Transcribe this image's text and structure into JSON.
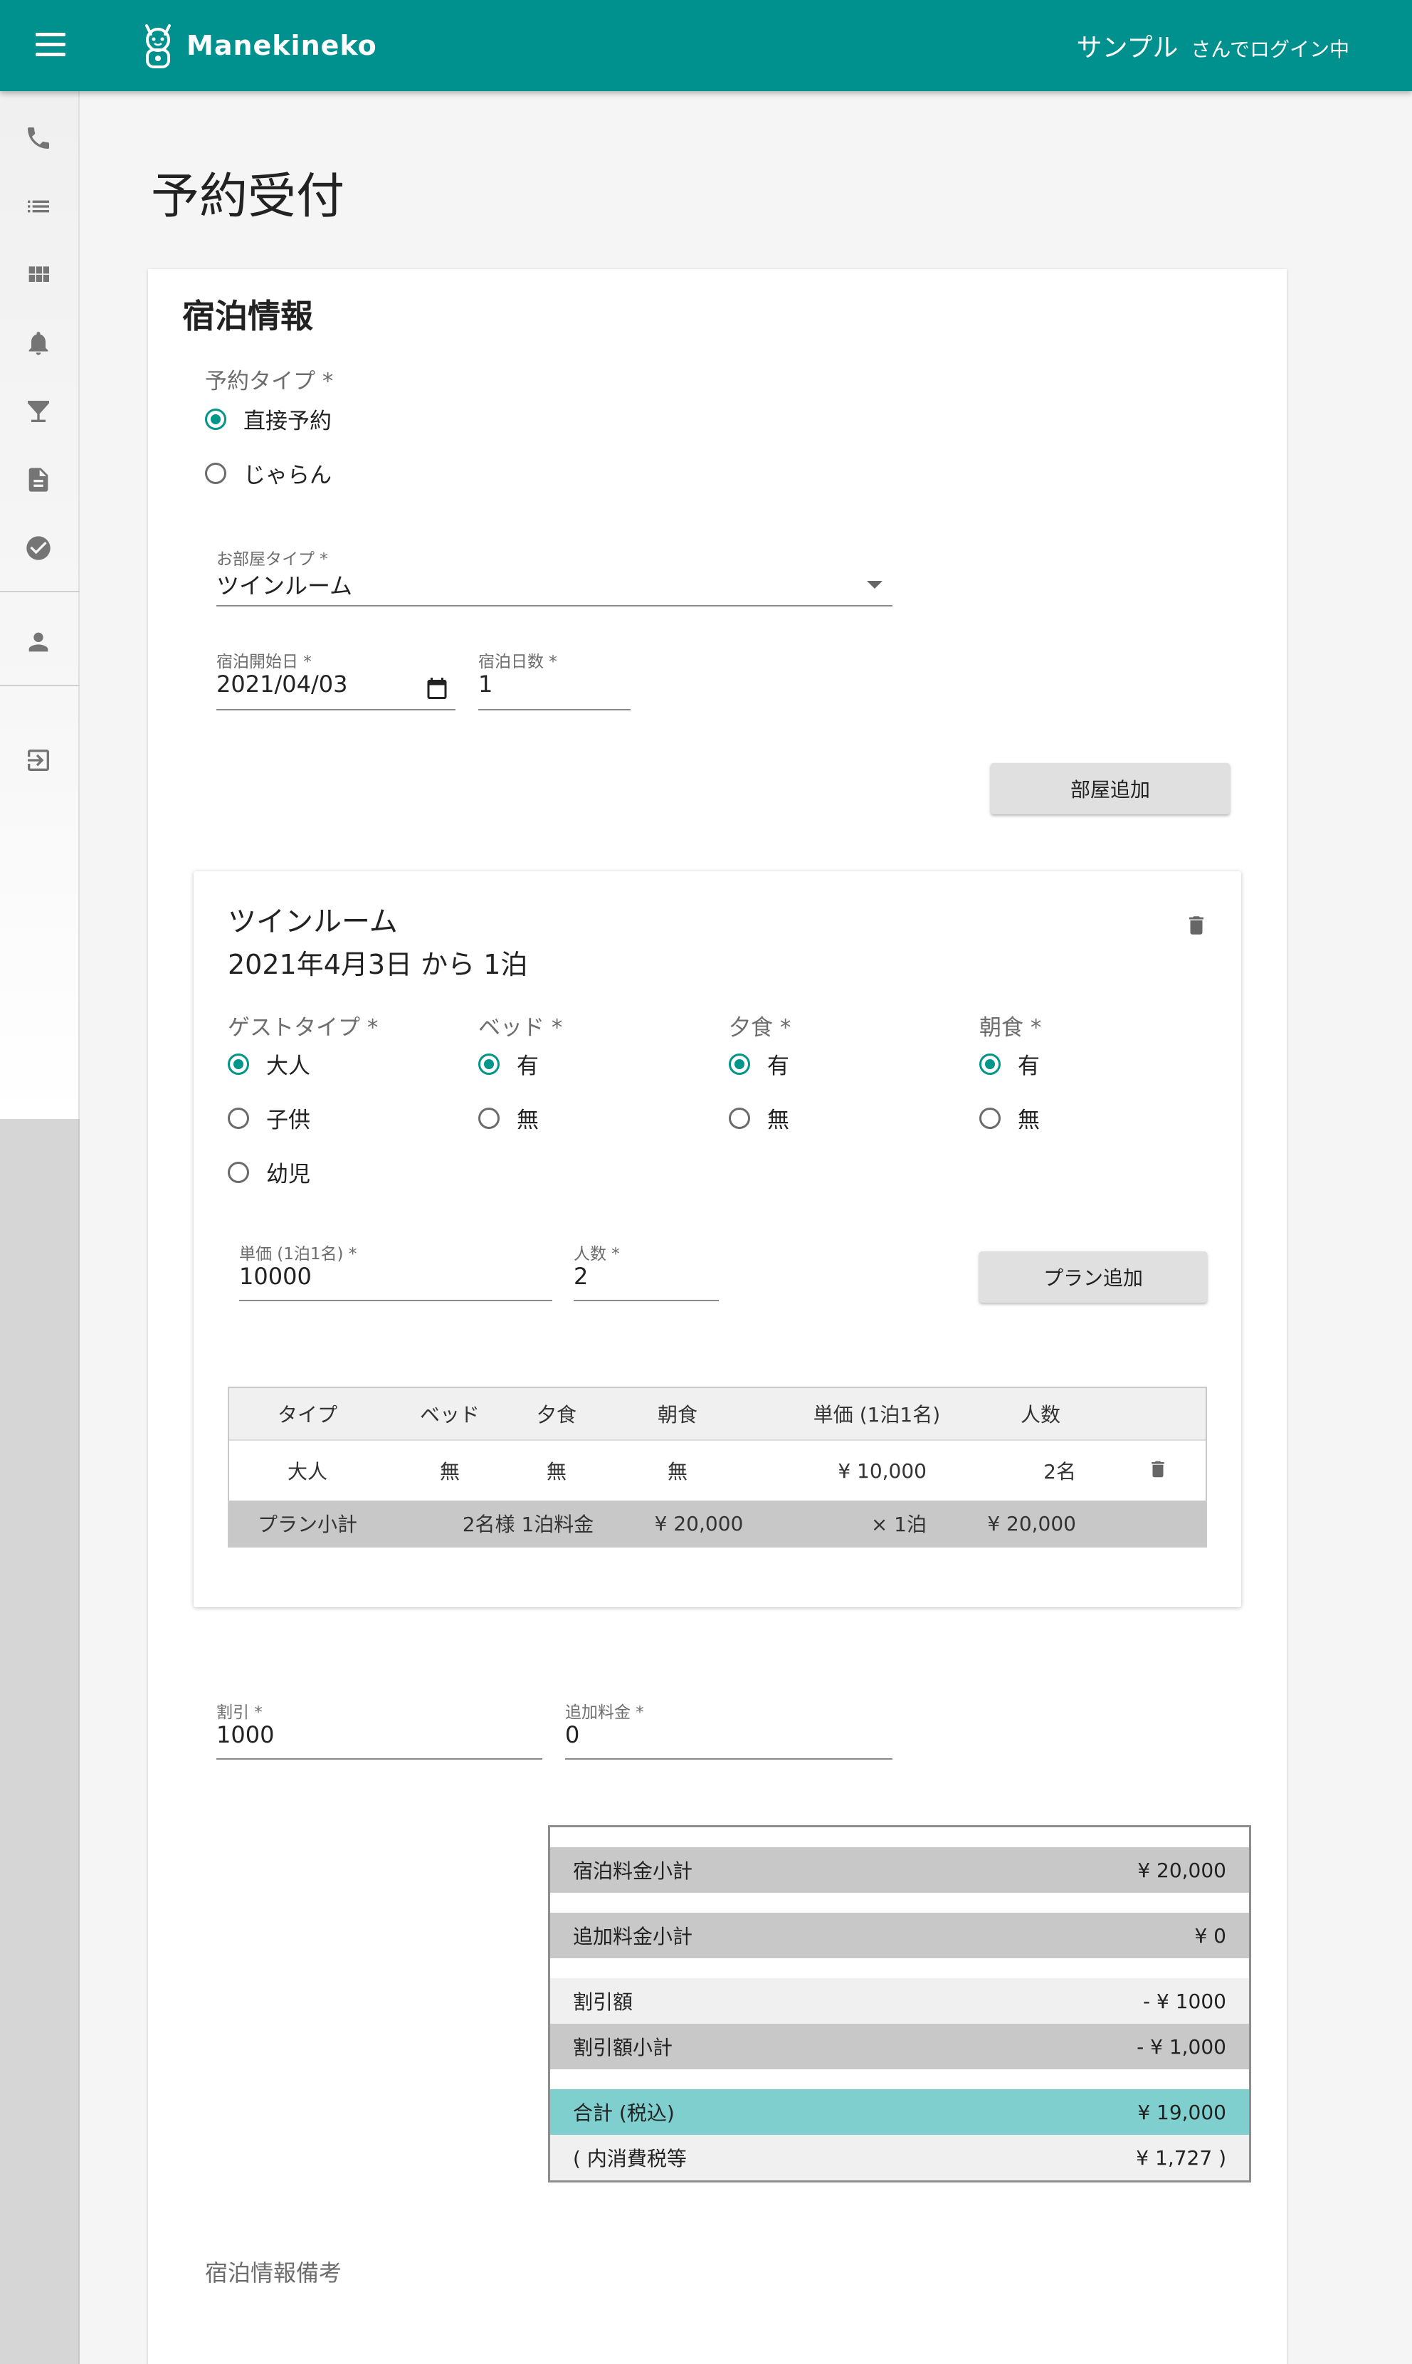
{
  "app": {
    "brand": "Manekineko",
    "login_name": "サンプル",
    "login_suffix": "さんでログイン中"
  },
  "sidebar": {
    "items": [
      {
        "icon": "phone-icon"
      },
      {
        "icon": "list-icon"
      },
      {
        "icon": "grid-icon"
      },
      {
        "icon": "bell-icon"
      },
      {
        "icon": "cocktail-icon"
      },
      {
        "icon": "document-icon"
      },
      {
        "icon": "check-circle-icon"
      },
      {
        "icon": "person-icon"
      },
      {
        "icon": "logout-icon"
      }
    ]
  },
  "page": {
    "title": "予約受付"
  },
  "stay": {
    "section_title": "宿泊情報",
    "reservation_type_label": "予約タイプ *",
    "reservation_types": [
      {
        "label": "直接予約",
        "selected": true
      },
      {
        "label": "じゃらん",
        "selected": false
      }
    ],
    "room_type_label": "お部屋タイプ *",
    "room_type_value": "ツインルーム",
    "start_date_label": "宿泊開始日 *",
    "start_date_value": "2021/04/03",
    "nights_label": "宿泊日数 *",
    "nights_value": "1",
    "add_room_button": "部屋追加"
  },
  "room": {
    "title": "ツインルーム",
    "subtitle": "2021年4月3日 から 1泊",
    "guest_type": {
      "label": "ゲストタイプ *",
      "options": [
        {
          "label": "大人",
          "selected": true
        },
        {
          "label": "子供",
          "selected": false
        },
        {
          "label": "幼児",
          "selected": false
        }
      ]
    },
    "bed": {
      "label": "ベッド *",
      "options": [
        {
          "label": "有",
          "selected": true
        },
        {
          "label": "無",
          "selected": false
        }
      ]
    },
    "dinner": {
      "label": "夕食 *",
      "options": [
        {
          "label": "有",
          "selected": true
        },
        {
          "label": "無",
          "selected": false
        }
      ]
    },
    "breakfast": {
      "label": "朝食 *",
      "options": [
        {
          "label": "有",
          "selected": true
        },
        {
          "label": "無",
          "selected": false
        }
      ]
    },
    "unit_price_label": "単価 (1泊1名) *",
    "unit_price_value": "10000",
    "people_label": "人数 *",
    "people_value": "2",
    "add_plan_button": "プラン追加",
    "table": {
      "headers": [
        "タイプ",
        "ベッド",
        "夕食",
        "朝食",
        "単価 (1泊1名)",
        "人数"
      ],
      "rows": [
        {
          "type": "大人",
          "bed": "無",
          "dinner": "無",
          "breakfast": "無",
          "unit_price": "¥ 10,000",
          "people": "2名"
        }
      ],
      "subtotal": {
        "label": "プラン小計",
        "desc": "2名様 1泊料金",
        "price": "¥ 20,000",
        "nights": "× 1泊",
        "total": "¥ 20,000"
      }
    }
  },
  "discount": {
    "label": "割引 *",
    "value": "1000"
  },
  "extra_fee": {
    "label": "追加料金 *",
    "value": "0"
  },
  "summary": {
    "rows": [
      {
        "label": "宿泊料金小計",
        "value": "¥ 20,000"
      },
      {
        "label": "追加料金小計",
        "value": "¥ 0"
      },
      {
        "label": "割引額",
        "value": "- ¥ 1000"
      },
      {
        "label": "割引額小計",
        "value": "- ¥ 1,000"
      },
      {
        "label": "合計 (税込)",
        "value": "¥ 19,000"
      },
      {
        "label": "( 内消費税等",
        "value": "¥ 1,727 )"
      }
    ]
  },
  "notes": {
    "label": "宿泊情報備考"
  },
  "colors": {
    "brand": "#00918e",
    "accent": "#009688",
    "total_row": "#7fcfcf"
  }
}
